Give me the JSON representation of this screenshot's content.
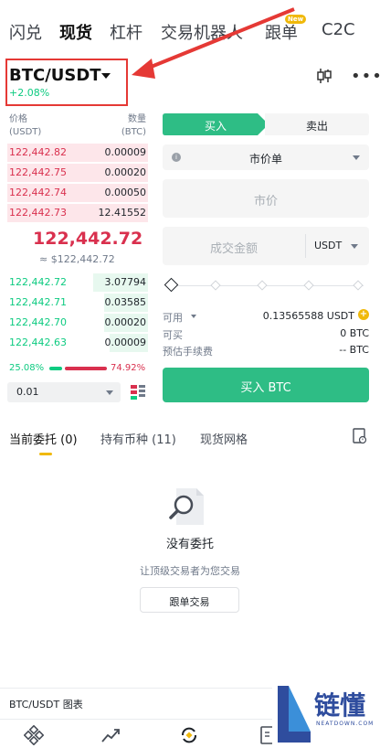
{
  "top_tabs": [
    "闪兑",
    "现货",
    "杠杆",
    "交易机器人",
    "跟单",
    "C2C"
  ],
  "new_badge": "New",
  "pair": {
    "name": "BTC/USDT",
    "change": "+2.08%"
  },
  "orderbook": {
    "price_header": "价格",
    "price_unit": "(USDT)",
    "qty_header": "数量",
    "qty_unit": "(BTC)",
    "asks": [
      {
        "price": "122,442.82",
        "qty": "0.00009"
      },
      {
        "price": "122,442.75",
        "qty": "0.00020"
      },
      {
        "price": "122,442.74",
        "qty": "0.00050"
      },
      {
        "price": "122,442.73",
        "qty": "12.41552"
      }
    ],
    "last_price": "122,442.72",
    "last_fiat": "≈ $122,442.72",
    "bids": [
      {
        "price": "122,442.72",
        "qty": "3.07794"
      },
      {
        "price": "122,442.71",
        "qty": "0.03585"
      },
      {
        "price": "122,442.70",
        "qty": "0.00020"
      },
      {
        "price": "122,442.63",
        "qty": "0.00009"
      }
    ],
    "buy_ratio": "25.08%",
    "sell_ratio": "74.92%",
    "depth": "0.01"
  },
  "form": {
    "buy_tab": "买入",
    "sell_tab": "卖出",
    "order_type": "市价单",
    "price_placeholder": "市价",
    "amount_placeholder": "成交金额",
    "amount_unit": "USDT",
    "available_label": "可用",
    "available_value": "0.13565588 USDT",
    "can_buy_label": "可买",
    "can_buy_value": "0 BTC",
    "fee_label": "预估手续费",
    "fee_value": "-- BTC",
    "buy_button": "买入 BTC"
  },
  "orders": {
    "tabs": [
      "当前委托 (0)",
      "持有币种 (11)",
      "现货网格"
    ],
    "empty_title": "没有委托",
    "empty_subtitle": "让顶级交易者为您交易",
    "copy_button": "跟单交易"
  },
  "chart_bar_label": "BTC/USDT 图表",
  "watermark": {
    "text": "链懂",
    "sub": "NEATDOWN.COM",
    "letter": "L"
  },
  "colors": {
    "buy": "#0ecb81",
    "sell": "#d9304e",
    "accent": "#f0b90b",
    "highlight": "#e53935"
  }
}
